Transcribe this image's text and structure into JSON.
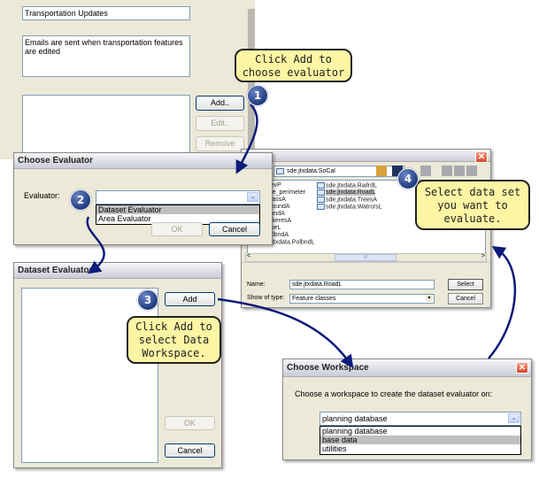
{
  "background_dialog": {
    "name_value": "Transportation Updates",
    "description_value": "Emails are sent when transportation features are edited",
    "buttons": {
      "add": "Add..",
      "edit": "Edit..",
      "remove": "Remove"
    }
  },
  "choose_evaluator": {
    "title": "Choose Evaluator",
    "evaluator_label": "Evaluator:",
    "evaluator_value": "",
    "options": [
      "Dataset Evaluator",
      "Area Evaluator"
    ],
    "highlighted_option": "Dataset Evaluator",
    "ok_label": "OK",
    "cancel_label": "Cancel"
  },
  "dataset_evaluator": {
    "title": "Dataset Evaluator",
    "add_label": "Add",
    "ok_label": "OK",
    "cancel_label": "Cancel"
  },
  "browse_dialog": {
    "location": "sde.jtxdata.SoCal",
    "files_col1": [
      "data.ElevP",
      "data.Fire_perimeter",
      "data.GrassA",
      "data.GroundA",
      "data.InundA",
      "data.LakeresA",
      "data.PipeL",
      "data.PolbndA",
      "sde.jtxdata.PolbndL"
    ],
    "files_col2": [
      "sde.jtxdata.RailrdL",
      "sde.jtxdata.RoadL",
      "sde.jtxdata.TreesA",
      "sde.jtxdata.WatrcrsL"
    ],
    "selected_file": "sde.jtxdata.RoadL",
    "name_label": "Name:",
    "name_value": "sde.jtxdata.RoadL",
    "type_label": "Show of type:",
    "type_value": "Feature classes",
    "select_label": "Select",
    "cancel_label": "Cancel",
    "scroll_left": "<",
    "scroll_right": ">",
    "scroll_thumb": "III"
  },
  "choose_workspace": {
    "title": "Choose Workspace",
    "prompt": "Choose a workspace to create the dataset evaluator on:",
    "selected_value": "planning database",
    "options": [
      "planning database",
      "base data",
      "utilities"
    ],
    "highlighted_option": "base data",
    "close_glyph": "✕"
  },
  "callouts": [
    {
      "step": "1",
      "text": "Click Add to choose evaluator"
    },
    {
      "step": "2",
      "text": ""
    },
    {
      "step": "3",
      "text": "Click Add to select Data Workspace."
    },
    {
      "step": "4",
      "text": "Select data set you want to evaluate."
    }
  ],
  "glyphs": {
    "dropdown_arrow": "⌄",
    "combo_arrow": "▾",
    "close": "✕"
  }
}
